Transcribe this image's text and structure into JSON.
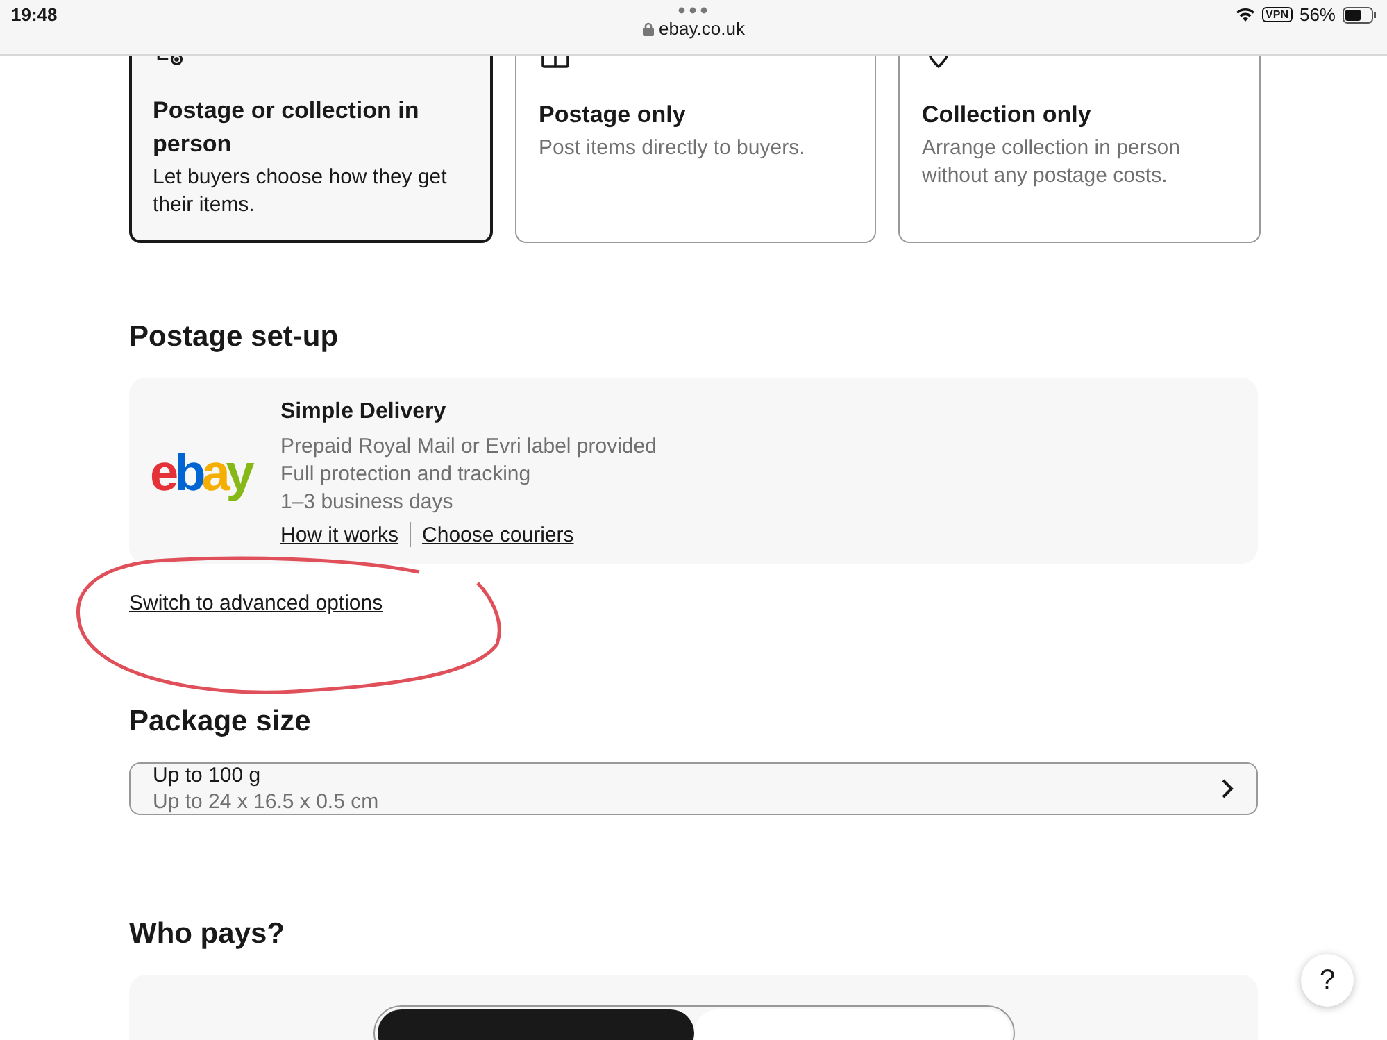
{
  "status_bar": {
    "time": "19:48",
    "vpn": "VPN",
    "battery": "56%"
  },
  "browser": {
    "url": "ebay.co.uk"
  },
  "delivery_options": [
    {
      "title": "Postage or collection in person",
      "description": "Let buyers choose how they get their items.",
      "selected": true,
      "kind": "both"
    },
    {
      "title": "Postage only",
      "description": "Post items directly to buyers.",
      "selected": false,
      "kind": "postage"
    },
    {
      "title": "Collection only",
      "description": "Arrange collection in person without any postage costs.",
      "selected": false,
      "kind": "collection"
    }
  ],
  "postage_setup": {
    "heading": "Postage set-up",
    "logo": "ebay",
    "title": "Simple Delivery",
    "lines": [
      "Prepaid Royal Mail or Evri label provided",
      "Full protection and tracking",
      "1–3 business days"
    ],
    "links": [
      "How it works",
      "Choose couriers"
    ],
    "advanced_link": "Switch to advanced options"
  },
  "package_size": {
    "heading": "Package size",
    "title": "Up to 100 g",
    "subtitle": "Up to 24 x 16.5 x 0.5 cm"
  },
  "who_pays": {
    "heading": "Who pays?",
    "options": [
      {
        "selected": true
      },
      {
        "selected": false
      }
    ]
  },
  "help_button": "?"
}
